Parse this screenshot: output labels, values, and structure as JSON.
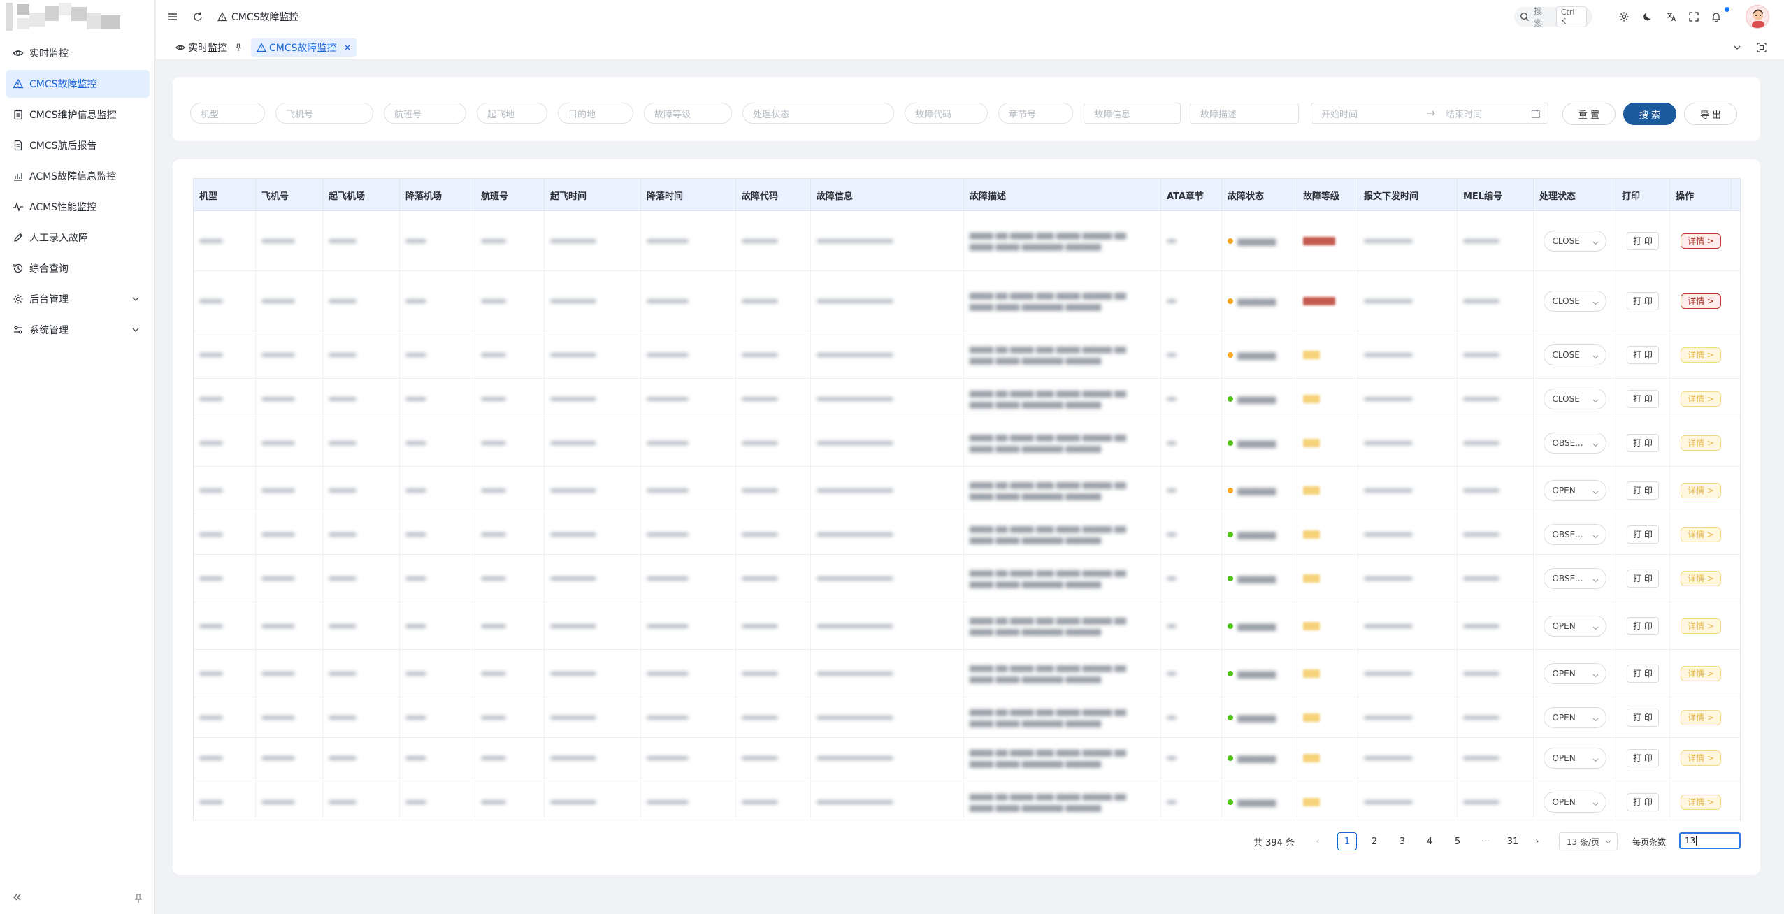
{
  "sidebar": {
    "items": [
      {
        "label": "实时监控",
        "icon": "eye-icon",
        "name": "sidebar-item-realtime"
      },
      {
        "label": "CMCS故障监控",
        "icon": "warning-icon",
        "name": "sidebar-item-cmcs-fault",
        "active": true
      },
      {
        "label": "CMCS维护信息监控",
        "icon": "clipboard-icon",
        "name": "sidebar-item-cmcs-maintenance"
      },
      {
        "label": "CMCS航后报告",
        "icon": "document-icon",
        "name": "sidebar-item-cmcs-report"
      },
      {
        "label": "ACMS故障信息监控",
        "icon": "bar-chart-icon",
        "name": "sidebar-item-acms-fault"
      },
      {
        "label": "ACMS性能监控",
        "icon": "pulse-icon",
        "name": "sidebar-item-acms-performance"
      },
      {
        "label": "人工录入故障",
        "icon": "edit-icon",
        "name": "sidebar-item-manual-entry"
      },
      {
        "label": "综合查询",
        "icon": "history-icon",
        "name": "sidebar-item-query"
      },
      {
        "label": "后台管理",
        "icon": "gear-icon",
        "name": "sidebar-item-backend",
        "expandable": true
      },
      {
        "label": "系统管理",
        "icon": "sliders-icon",
        "name": "sidebar-item-system",
        "expandable": true
      }
    ]
  },
  "header": {
    "breadcrumb": "CMCS故障监控",
    "search_label": "搜索",
    "search_shortcut": "Ctrl K"
  },
  "tabs": [
    {
      "label": "实时监控",
      "icon": "eye-icon"
    },
    {
      "label": "CMCS故障监控",
      "icon": "warning-icon",
      "active": true
    }
  ],
  "filters": {
    "aircraft_type": "机型",
    "tail_number": "飞机号",
    "flight_number": "航班号",
    "departure": "起飞地",
    "destination": "目的地",
    "fault_level": "故障等级",
    "handling_status": "处理状态",
    "fault_code": "故障代码",
    "chapter": "章节号",
    "fault_info": "故障信息",
    "fault_desc": "故障描述",
    "start_time": "开始时间",
    "end_time": "结束时间",
    "reset": "重 置",
    "search": "搜 索",
    "export": "导 出"
  },
  "table": {
    "columns": [
      "机型",
      "飞机号",
      "起飞机场",
      "降落机场",
      "航班号",
      "起飞时间",
      "降落时间",
      "故障代码",
      "故障信息",
      "故障描述",
      "ATA章节",
      "故障状态",
      "故障等级",
      "报文下发时间",
      "MEL编号",
      "处理状态",
      "打印",
      "操作"
    ],
    "rows": [
      {
        "status": "CLOSE",
        "print": "打 印",
        "action": "详情 >",
        "action_style": "red",
        "h": 86,
        "state_color": "#f5a623",
        "level_style": "red"
      },
      {
        "status": "CLOSE",
        "print": "打 印",
        "action": "详情 >",
        "action_style": "red",
        "h": 86,
        "state_color": "#f5a623",
        "level_style": "red"
      },
      {
        "status": "CLOSE",
        "print": "打 印",
        "action": "详情 >",
        "action_style": "faint",
        "h": 68,
        "state_color": "#f5a623",
        "level_style": "yellow"
      },
      {
        "status": "CLOSE",
        "print": "打 印",
        "action": "详情 >",
        "action_style": "faint",
        "h": 58,
        "state_color": "#52c41a",
        "level_style": "yellow"
      },
      {
        "status": "OBSE...",
        "print": "打 印",
        "action": "详情 >",
        "action_style": "faint",
        "h": 68,
        "state_color": "#52c41a",
        "level_style": "yellow"
      },
      {
        "status": "OPEN",
        "print": "打 印",
        "action": "详情 >",
        "action_style": "faint",
        "h": 68,
        "state_color": "#f5a623",
        "level_style": "yellow"
      },
      {
        "status": "OBSE...",
        "print": "打 印",
        "action": "详情 >",
        "action_style": "faint",
        "h": 58,
        "state_color": "#52c41a",
        "level_style": "yellow"
      },
      {
        "status": "OBSE...",
        "print": "打 印",
        "action": "详情 >",
        "action_style": "faint",
        "h": 68,
        "state_color": "#52c41a",
        "level_style": "yellow"
      },
      {
        "status": "OPEN",
        "print": "打 印",
        "action": "详情 >",
        "action_style": "faint",
        "h": 68,
        "state_color": "#52c41a",
        "level_style": "yellow"
      },
      {
        "status": "OPEN",
        "print": "打 印",
        "action": "详情 >",
        "action_style": "faint",
        "h": 68,
        "state_color": "#52c41a",
        "level_style": "yellow"
      },
      {
        "status": "OPEN",
        "print": "打 印",
        "action": "详情 >",
        "action_style": "faint",
        "h": 58,
        "state_color": "#52c41a",
        "level_style": "yellow"
      },
      {
        "status": "OPEN",
        "print": "打 印",
        "action": "详情 >",
        "action_style": "faint",
        "h": 58,
        "state_color": "#52c41a",
        "level_style": "yellow"
      },
      {
        "status": "OPEN",
        "print": "打 印",
        "action": "详情 >",
        "action_style": "faint",
        "h": 68,
        "state_color": "#52c41a",
        "level_style": "yellow"
      }
    ]
  },
  "pagination": {
    "total": "共 394 条",
    "pages": [
      "1",
      "2",
      "3",
      "4",
      "5",
      "···",
      "31"
    ],
    "current": "1",
    "page_size": "13 条/页",
    "goto_label": "每页条数",
    "goto_value": "13"
  },
  "colors": {
    "accent": "#1a66d8",
    "primary_button": "#1b5a9c",
    "active_nav_bg": "#e3eeff",
    "table_header_bg": "#eaf2ff"
  }
}
